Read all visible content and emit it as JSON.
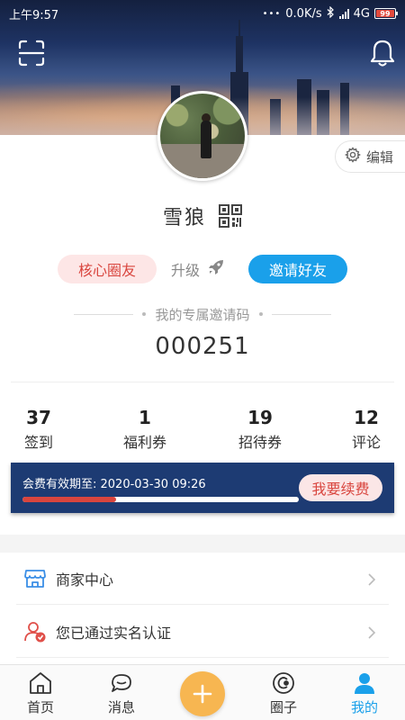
{
  "status_bar": {
    "time": "上午9:57",
    "speed": "0.0K/s",
    "network": "4G",
    "battery": "99"
  },
  "header": {
    "scan_icon": "scan-icon",
    "bell_icon": "bell-icon",
    "edit_label": "编辑"
  },
  "profile": {
    "name": "雪狼",
    "core_badge": "核心圈友",
    "upgrade_label": "升级",
    "invite_button": "邀请好友",
    "invite_code_title": "我的专属邀请码",
    "invite_code": "000251"
  },
  "stats": [
    {
      "value": "37",
      "label": "签到"
    },
    {
      "value": "1",
      "label": "福利券"
    },
    {
      "value": "19",
      "label": "招待券"
    },
    {
      "value": "12",
      "label": "评论"
    }
  ],
  "membership": {
    "expiry_text": "会费有效期至: 2020-03-30 09:26",
    "progress": 0.34,
    "renew_button": "我要续费"
  },
  "menu": [
    {
      "label": "商家中心",
      "icon": "store-icon"
    },
    {
      "label": "您已通过实名认证",
      "icon": "verified-user-icon"
    }
  ],
  "tabbar": {
    "tabs": [
      {
        "label": "首页",
        "icon": "home-icon"
      },
      {
        "label": "消息",
        "icon": "message-icon"
      },
      {
        "label": "圈子",
        "icon": "circle-icon"
      },
      {
        "label": "我的",
        "icon": "user-icon"
      }
    ],
    "active": "我的",
    "accent": "#1aa0ea"
  },
  "colors": {
    "accent_blue": "#1aa0ea",
    "accent_red": "#d9453e",
    "membership_bg": "#1d3b73",
    "fab": "#f7b651"
  }
}
